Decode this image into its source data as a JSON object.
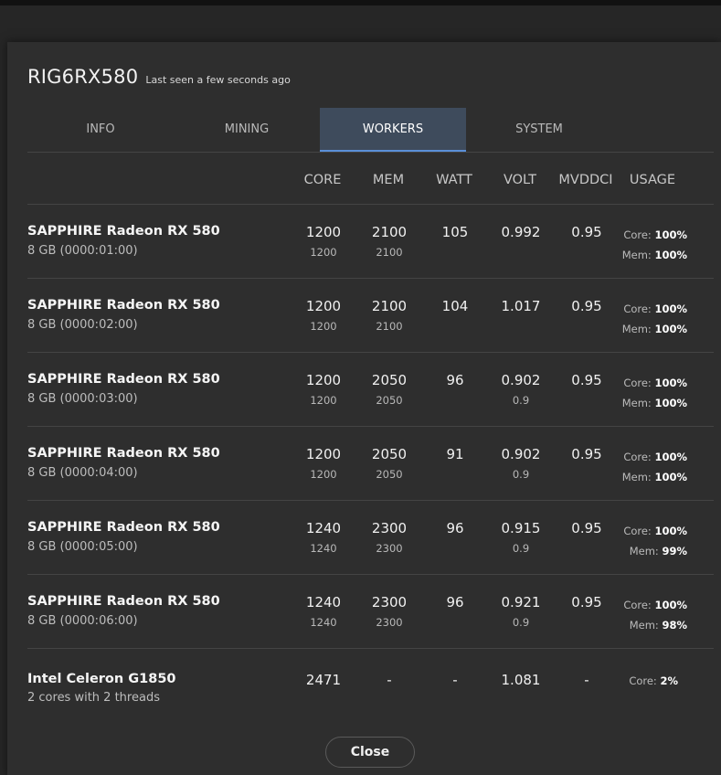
{
  "rig": {
    "name": "RIG6RX580",
    "last_seen": "Last seen a few seconds ago"
  },
  "tabs": [
    {
      "label": "INFO",
      "active": false
    },
    {
      "label": "MINING",
      "active": false
    },
    {
      "label": "WORKERS",
      "active": true
    },
    {
      "label": "SYSTEM",
      "active": false
    }
  ],
  "columns": [
    "CORE",
    "MEM",
    "WATT",
    "VOLT",
    "MVDDCI",
    "USAGE"
  ],
  "workers": [
    {
      "name": "SAPPHIRE Radeon RX 580",
      "sub": "8 GB (0000:01:00)",
      "core": "1200",
      "core_sub": "1200",
      "mem": "2100",
      "mem_sub": "2100",
      "watt": "105",
      "volt": "0.992",
      "volt_sub": "",
      "mvddci": "0.95",
      "usage_core_label": "Core:",
      "usage_core": "100%",
      "usage_mem_label": "Mem:",
      "usage_mem": "100%"
    },
    {
      "name": "SAPPHIRE Radeon RX 580",
      "sub": "8 GB (0000:02:00)",
      "core": "1200",
      "core_sub": "1200",
      "mem": "2100",
      "mem_sub": "2100",
      "watt": "104",
      "volt": "1.017",
      "volt_sub": "",
      "mvddci": "0.95",
      "usage_core_label": "Core:",
      "usage_core": "100%",
      "usage_mem_label": "Mem:",
      "usage_mem": "100%"
    },
    {
      "name": "SAPPHIRE Radeon RX 580",
      "sub": "8 GB (0000:03:00)",
      "core": "1200",
      "core_sub": "1200",
      "mem": "2050",
      "mem_sub": "2050",
      "watt": "96",
      "volt": "0.902",
      "volt_sub": "0.9",
      "mvddci": "0.95",
      "usage_core_label": "Core:",
      "usage_core": "100%",
      "usage_mem_label": "Mem:",
      "usage_mem": "100%"
    },
    {
      "name": "SAPPHIRE Radeon RX 580",
      "sub": "8 GB (0000:04:00)",
      "core": "1200",
      "core_sub": "1200",
      "mem": "2050",
      "mem_sub": "2050",
      "watt": "91",
      "volt": "0.902",
      "volt_sub": "0.9",
      "mvddci": "0.95",
      "usage_core_label": "Core:",
      "usage_core": "100%",
      "usage_mem_label": "Mem:",
      "usage_mem": "100%"
    },
    {
      "name": "SAPPHIRE Radeon RX 580",
      "sub": "8 GB (0000:05:00)",
      "core": "1240",
      "core_sub": "1240",
      "mem": "2300",
      "mem_sub": "2300",
      "watt": "96",
      "volt": "0.915",
      "volt_sub": "0.9",
      "mvddci": "0.95",
      "usage_core_label": "Core:",
      "usage_core": "100%",
      "usage_mem_label": "Mem:",
      "usage_mem": "99%"
    },
    {
      "name": "SAPPHIRE Radeon RX 580",
      "sub": "8 GB (0000:06:00)",
      "core": "1240",
      "core_sub": "1240",
      "mem": "2300",
      "mem_sub": "2300",
      "watt": "96",
      "volt": "0.921",
      "volt_sub": "0.9",
      "mvddci": "0.95",
      "usage_core_label": "Core:",
      "usage_core": "100%",
      "usage_mem_label": "Mem:",
      "usage_mem": "98%"
    }
  ],
  "cpu": {
    "name": "Intel Celeron G1850",
    "sub": "2 cores with 2 threads",
    "core": "2471",
    "mem": "-",
    "watt": "-",
    "volt": "1.081",
    "mvddci": "-",
    "usage_core_label": "Core:",
    "usage_core": "2%"
  },
  "close_label": "Close",
  "colors": {
    "active_tab_bg": "#3e4b5c",
    "active_tab_underline": "#5a8fd8",
    "modal_bg": "#2e2e2e"
  }
}
